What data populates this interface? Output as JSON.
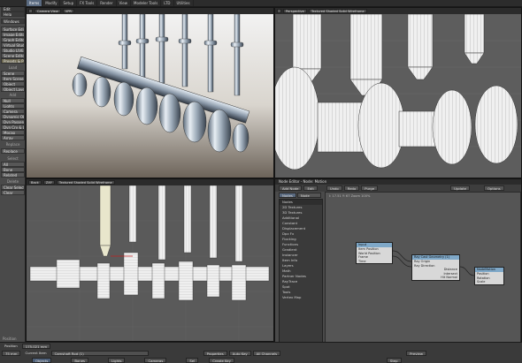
{
  "menubar": {
    "tabs": [
      "Items",
      "Modify",
      "Setup",
      "FX Tools",
      "Render",
      "View",
      "Modeler Tools",
      "LTD",
      "Utilities"
    ],
    "active_index": 0
  },
  "toolbar": {
    "top": [
      "File",
      "Edit",
      "Help",
      "Windows"
    ],
    "group1": [
      "Surface Editor",
      "Image Editor",
      "Graph Editor",
      "Virtual Studio",
      "Studio LIVE",
      "Scene Editor",
      "Presets & Place"
    ],
    "section_load": "Load",
    "group2": [
      "Scene",
      "Item Scene",
      "Object",
      "Object Layer"
    ],
    "section_add": "Add",
    "group3": [
      "Null",
      "Lights",
      "Camera",
      "Dynamic Obj",
      "Dyn Passenger",
      "Dyn Crv & Lf",
      "Mocap",
      "Array"
    ],
    "section_replace": "Replace",
    "replace_value": "Replace",
    "section_select": "Select",
    "group4": [
      "All",
      "Bone",
      "Related"
    ],
    "section_delete": "Delete",
    "group5": [
      "Clear Selected",
      "Clear"
    ],
    "position_label": "Position"
  },
  "viewports": {
    "top_left": {
      "camera": "Camera View",
      "mode": "VPR"
    },
    "top_right": {
      "view": "Perspective",
      "shading": "Textured Shaded Solid Wireframe"
    },
    "bottom_left": {
      "view": "Back",
      "zoom": "ZXY",
      "shading": "Textured Shaded Solid Wireframe"
    }
  },
  "node_editor": {
    "title": "Node Editor - Node: Motion",
    "menu": [
      "Add Node",
      "Edit",
      "Undo",
      "Redo",
      "Purge"
    ],
    "right_controls": [
      "Update",
      "Options"
    ],
    "tabs": [
      "Nodes",
      "Node Prop..."
    ],
    "list_header": "Nodes",
    "list_items": [
      "2D Textures",
      "3D Textures",
      "Additional",
      "Constant",
      "Displacement",
      "Dpx Fx",
      "Flocking",
      "Functions",
      "Gradient",
      "Instancer",
      "Item Info",
      "Layers",
      "Math",
      "Partner Nodes",
      "RayTrace",
      "Spot",
      "Tools",
      "Vertex Map"
    ],
    "canvas_info": "I: 17.51 Y: 67 Zoom 100%",
    "nodes": {
      "input": {
        "title": "Input",
        "rows": [
          "Item Position",
          "World Position",
          "Frame",
          "Time"
        ]
      },
      "raycast": {
        "title": "Ray Cast Geometry (1)",
        "rows": [
          "Ray Origin",
          "Ray Direction",
          "Distance",
          "Intersect",
          "Hit Normal"
        ]
      },
      "motion": {
        "title": "NodeMotion",
        "rows": [
          "Position",
          "Rotation",
          "Scale"
        ]
      }
    }
  },
  "bottombar": {
    "row1": [
      "Position",
      "175.021 mm"
    ],
    "row2": [
      "75 mm",
      "Current Item",
      "Camshaft Rod (1)",
      "Properties",
      "Auto Key",
      "All Channels",
      "Preview"
    ],
    "row3": [
      "Objects",
      "Bones",
      "Lights",
      "Cameras",
      "Sel",
      "Create Key",
      "Step"
    ]
  }
}
